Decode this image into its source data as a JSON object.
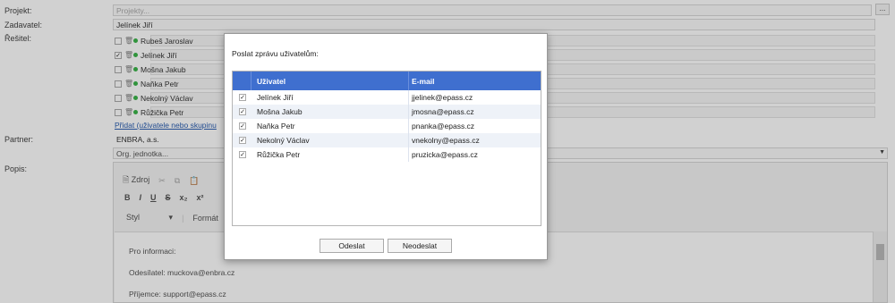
{
  "form": {
    "project_label": "Projekt:",
    "project_placeholder": "Projekty...",
    "project_button": "...",
    "requester_label": "Zadavatel:",
    "requester_value": "Jelínek Jiří",
    "solver_label": "Řešitel:",
    "solvers": [
      {
        "name": "Rubeš Jaroslav",
        "checked": false
      },
      {
        "name": "Jelínek Jiří",
        "checked": true
      },
      {
        "name": "Mošna Jakub",
        "checked": false
      },
      {
        "name": "Naňka Petr",
        "checked": false
      },
      {
        "name": "Nekolný Václav",
        "checked": false
      },
      {
        "name": "Růžička Petr",
        "checked": false
      }
    ],
    "add_link": "Přidat (uživatele nebo skupinu",
    "partner_label": "Partner:",
    "partner_value": "ENBRA, a.s.",
    "org_unit_placeholder": "Org. jednotka...",
    "description_label": "Popis:"
  },
  "editor": {
    "source_label": "Zdroj",
    "toolbar_row2": [
      "B",
      "I",
      "U",
      "S",
      "x₂",
      "x²"
    ],
    "style_label": "Styl",
    "format_label": "Formát",
    "content": [
      "Pro informaci:",
      "Odesílatel: muckova@enbra.cz",
      "Příjemce: support@epass.cz"
    ]
  },
  "dialog": {
    "title": "Poslat zprávu uživatelům:",
    "col_user": "Uživatel",
    "col_email": "E-mail",
    "rows": [
      {
        "name": "Jelínek Jiří",
        "email": "jjelinek@epass.cz",
        "checked": true
      },
      {
        "name": "Mošna Jakub",
        "email": "jmosna@epass.cz",
        "checked": true
      },
      {
        "name": "Naňka Petr",
        "email": "pnanka@epass.cz",
        "checked": true
      },
      {
        "name": "Nekolný Václav",
        "email": "vnekolny@epass.cz",
        "checked": true
      },
      {
        "name": "Růžička Petr",
        "email": "pruzicka@epass.cz",
        "checked": true
      }
    ],
    "send_button": "Odeslat",
    "cancel_button": "Neodeslat"
  },
  "colors": {
    "header_blue": "#3f6fcf",
    "status_green": "#3bb54a",
    "link_blue": "#2a5db0"
  }
}
